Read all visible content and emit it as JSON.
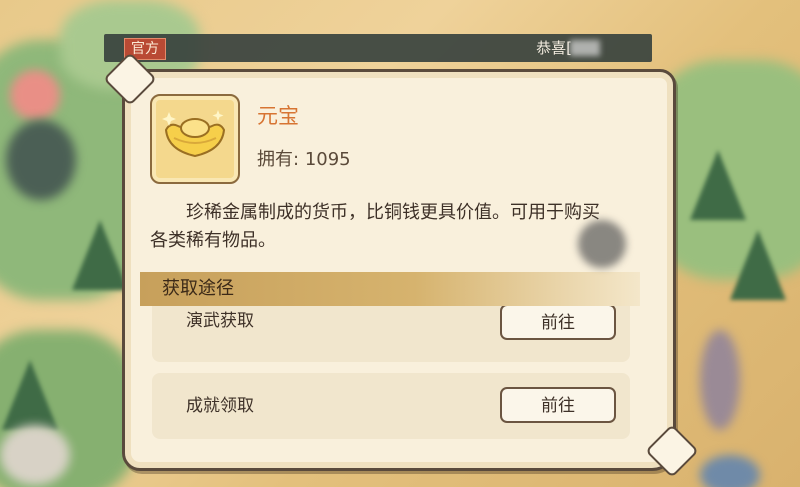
{
  "announcement": {
    "tag": "官方",
    "text": "恭喜["
  },
  "item": {
    "name": "元宝",
    "owned_label": "拥有:",
    "owned_count": "1095",
    "icon": "gold-ingot-icon",
    "description": "珍稀金属制成的货币，比铜钱更具价值。可用于购买各类稀有物品。"
  },
  "sources": {
    "header": "获取途径",
    "items": [
      {
        "label": "演武获取",
        "button": "前往"
      },
      {
        "label": "成就领取",
        "button": "前往"
      }
    ]
  },
  "colors": {
    "item_name": "#d77432",
    "official_tag": "#b94a34",
    "section_header": "#c7a05b"
  }
}
